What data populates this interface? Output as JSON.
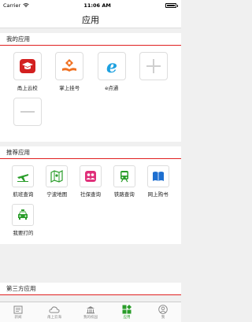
{
  "status": {
    "carrier": "Carrier",
    "time": "11:06 AM"
  },
  "nav": {
    "title": "应用"
  },
  "my_apps": {
    "header": "我的应用",
    "items": [
      {
        "label": "甬上云校",
        "icon": "graduation-cap-icon"
      },
      {
        "label": "掌上挂号",
        "icon": "hand-register-icon"
      },
      {
        "label": "e点通",
        "icon": "e-letter-icon"
      },
      {
        "label": "",
        "icon": "add-icon"
      },
      {
        "label": "",
        "icon": "remove-icon"
      }
    ]
  },
  "recommended": {
    "header": "推荐应用",
    "items": [
      {
        "label": "航班查询",
        "icon": "airplane-icon"
      },
      {
        "label": "宁波地图",
        "icon": "map-icon"
      },
      {
        "label": "社保查询",
        "icon": "people-icon"
      },
      {
        "label": "铁路查询",
        "icon": "train-icon"
      },
      {
        "label": "网上购书",
        "icon": "book-icon"
      },
      {
        "label": "我要打的",
        "icon": "taxi-icon"
      }
    ]
  },
  "third_party": {
    "header": "第三方应用"
  },
  "tabs": [
    {
      "label": "新闻",
      "icon": "newspaper-icon",
      "active": false
    },
    {
      "label": "甬上云海",
      "icon": "cloud-icon",
      "active": false
    },
    {
      "label": "我的校园",
      "icon": "school-icon",
      "active": false
    },
    {
      "label": "应用",
      "icon": "apps-grid-icon",
      "active": true
    },
    {
      "label": "我",
      "icon": "user-icon",
      "active": false
    }
  ],
  "colors": {
    "accent_red": "#e02020",
    "green": "#2a9d2a",
    "e_blue": "#1ea1e0"
  }
}
